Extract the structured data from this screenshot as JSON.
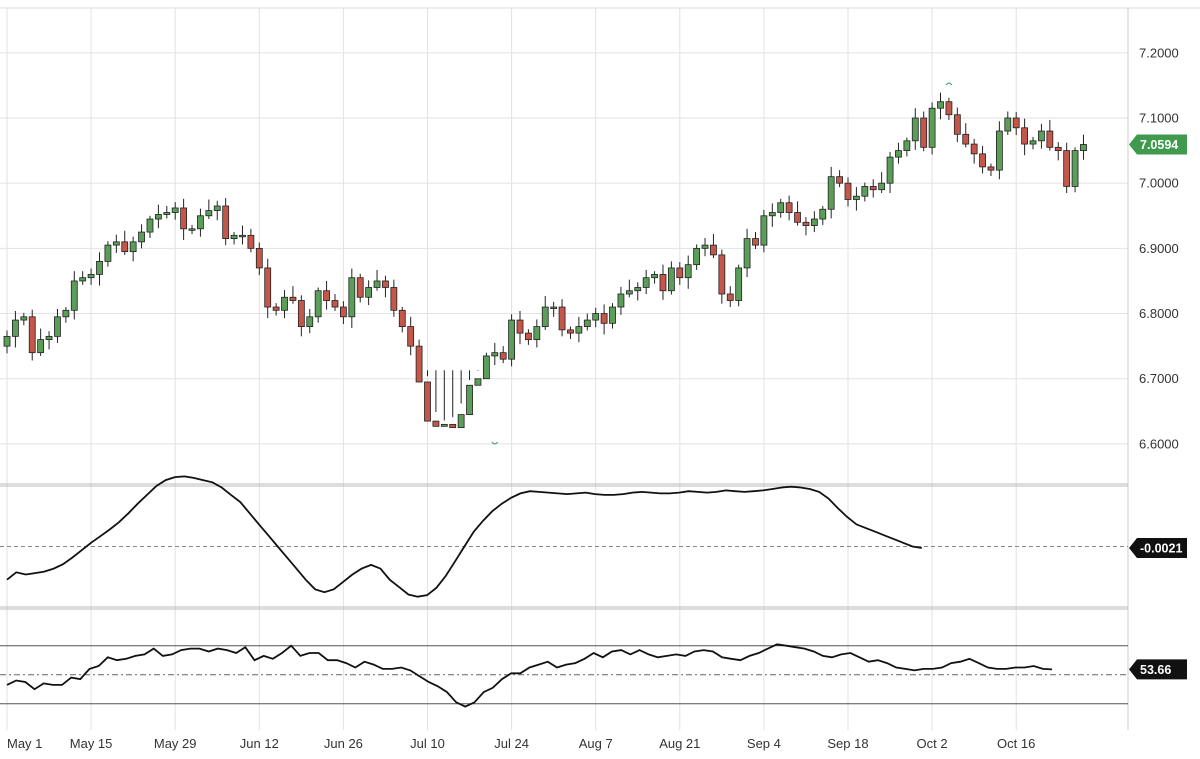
{
  "chart_data": [
    {
      "type": "candlestick",
      "title": "",
      "y_ticks": [
        "7.2000",
        "7.1000",
        "7.0000",
        "6.9000",
        "6.8000",
        "6.7000",
        "6.6000"
      ],
      "ylim": [
        6.56,
        7.235
      ],
      "last_value_label": "7.0594",
      "x_ticks": [
        {
          "label": "May 1",
          "index": 0
        },
        {
          "label": "May 15",
          "index": 10
        },
        {
          "label": "May 29",
          "index": 20
        },
        {
          "label": "Jun 12",
          "index": 30
        },
        {
          "label": "Jun 26",
          "index": 40
        },
        {
          "label": "Jul 10",
          "index": 50
        },
        {
          "label": "Jul 24",
          "index": 60
        },
        {
          "label": "Aug 7",
          "index": 70
        },
        {
          "label": "Aug 21",
          "index": 80
        },
        {
          "label": "Sep 4",
          "index": 90
        },
        {
          "label": "Sep 18",
          "index": 100
        },
        {
          "label": "Oct 2",
          "index": 110
        },
        {
          "label": "Oct 16",
          "index": 120
        }
      ],
      "close": [
        6.765,
        6.79,
        6.795,
        6.74,
        6.76,
        6.765,
        6.795,
        6.805,
        6.85,
        6.855,
        6.86,
        6.88,
        6.905,
        6.91,
        6.895,
        6.91,
        6.925,
        6.945,
        6.952,
        6.955,
        6.962,
        6.93,
        6.93,
        6.95,
        6.958,
        6.965,
        6.915,
        6.92,
        6.92,
        6.9,
        6.87,
        6.81,
        6.805,
        6.825,
        6.82,
        6.78,
        6.795,
        6.835,
        6.82,
        6.81,
        6.795,
        6.855,
        6.825,
        6.84,
        6.85,
        6.84,
        6.805,
        6.78,
        6.75,
        6.695,
        6.635,
        6.627,
        6.63,
        6.625,
        6.645,
        6.69,
        6.7,
        6.735,
        6.74,
        6.73,
        6.79,
        6.77,
        6.76,
        6.78,
        6.81,
        6.81,
        6.775,
        6.77,
        6.78,
        6.79,
        6.8,
        6.785,
        6.81,
        6.83,
        6.835,
        6.84,
        6.855,
        6.86,
        6.835,
        6.87,
        6.855,
        6.875,
        6.9,
        6.905,
        6.89,
        6.83,
        6.82,
        6.87,
        6.915,
        6.905,
        6.95,
        6.955,
        6.97,
        6.955,
        6.94,
        6.935,
        6.945,
        6.96,
        7.01,
        7.0,
        6.975,
        6.98,
        6.995,
        6.99,
        7.0,
        7.04,
        7.05,
        7.065,
        7.1,
        7.055,
        7.115,
        7.125,
        7.105,
        7.075,
        7.06,
        7.045,
        7.025,
        7.02,
        7.08,
        7.1,
        7.085,
        7.06,
        7.065,
        7.08,
        7.055,
        7.05,
        6.995,
        7.05,
        7.0594
      ],
      "wick_range": [
        6.713,
        7.146
      ],
      "markers": [
        {
          "type": "high",
          "index": 112,
          "value": 7.146
        },
        {
          "type": "low",
          "index": 58,
          "value": 6.6
        }
      ],
      "up_color": "#5a9e5a",
      "down_color": "#c4574a",
      "badge_color": "#3f9a4e"
    },
    {
      "type": "line",
      "title": "",
      "zero_line": 0,
      "last_value_label": "-0.0021",
      "values": [
        -0.045,
        -0.035,
        -0.038,
        -0.036,
        -0.034,
        -0.03,
        -0.024,
        -0.015,
        -0.005,
        0.005,
        0.014,
        0.023,
        0.033,
        0.045,
        0.058,
        0.07,
        0.082,
        0.09,
        0.094,
        0.095,
        0.093,
        0.09,
        0.087,
        0.08,
        0.07,
        0.06,
        0.045,
        0.03,
        0.015,
        0.0,
        -0.015,
        -0.03,
        -0.045,
        -0.058,
        -0.062,
        -0.058,
        -0.048,
        -0.038,
        -0.03,
        -0.025,
        -0.03,
        -0.045,
        -0.055,
        -0.065,
        -0.068,
        -0.066,
        -0.056,
        -0.04,
        -0.02,
        0.0,
        0.02,
        0.035,
        0.048,
        0.058,
        0.066,
        0.072,
        0.075,
        0.074,
        0.073,
        0.072,
        0.071,
        0.072,
        0.073,
        0.071,
        0.07,
        0.07,
        0.071,
        0.073,
        0.074,
        0.073,
        0.072,
        0.072,
        0.073,
        0.075,
        0.074,
        0.073,
        0.074,
        0.076,
        0.075,
        0.074,
        0.075,
        0.076,
        0.078,
        0.08,
        0.081,
        0.08,
        0.078,
        0.074,
        0.065,
        0.052,
        0.04,
        0.03,
        0.025,
        0.02,
        0.015,
        0.01,
        0.005,
        0.0,
        -0.002
      ],
      "x_start_index": 0,
      "x_step": 1.11,
      "ylim": [
        -0.082,
        0.082
      ]
    },
    {
      "type": "line",
      "title": "",
      "reference_lines": [
        70,
        50,
        30
      ],
      "last_value_label": "53.66",
      "values": [
        43,
        46,
        45,
        40,
        44,
        43,
        43,
        48,
        47,
        54,
        56,
        62,
        60,
        61,
        63,
        64,
        68,
        63,
        64,
        67,
        68,
        68,
        66,
        68,
        67,
        65,
        69,
        60,
        63,
        61,
        65,
        70,
        63,
        65,
        65,
        60,
        60,
        58,
        55,
        59,
        57,
        54,
        54,
        55,
        53,
        49,
        45,
        42,
        38,
        31,
        28,
        31,
        38,
        41,
        47,
        51,
        51,
        55,
        57,
        59,
        55,
        57,
        58,
        61,
        65,
        62,
        66,
        67,
        64,
        67,
        64,
        62,
        63,
        64,
        63,
        66,
        67,
        66,
        62,
        61,
        60,
        63,
        65,
        68,
        71,
        70,
        69,
        68,
        66,
        63,
        62,
        64,
        65,
        62,
        59,
        60,
        58,
        55,
        54,
        53,
        54,
        54,
        55,
        58,
        59,
        61,
        58,
        55,
        54,
        54,
        55,
        55,
        56,
        54,
        53.66
      ],
      "x_start_index": 0,
      "x_step": 1.09,
      "ylim": [
        25,
        76
      ]
    }
  ]
}
